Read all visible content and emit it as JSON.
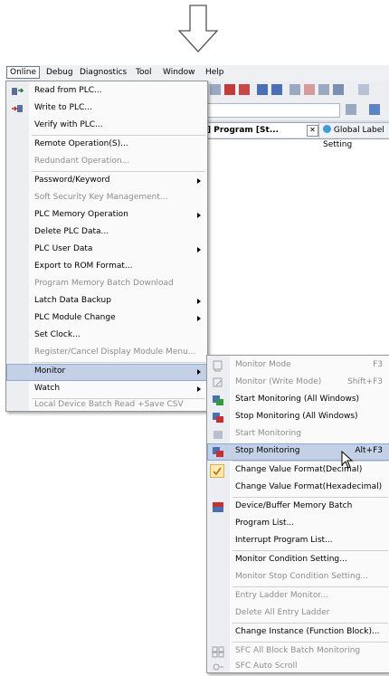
{
  "menubar": {
    "items": [
      "Online",
      "Debug",
      "Diagnostics",
      "Tool",
      "Window",
      "Help"
    ]
  },
  "tabs": {
    "program": "] Program [St...",
    "global": "Global Label Setting"
  },
  "online_menu": {
    "items": [
      {
        "label": "Read from PLC...",
        "enabled": true,
        "icon": "read-plc-icon"
      },
      {
        "label": "Write to PLC...",
        "enabled": true,
        "icon": "write-plc-icon"
      },
      {
        "label": "Verify with PLC...",
        "enabled": true
      },
      {
        "label": "Remote Operation(S)...",
        "enabled": true
      },
      {
        "label": "Redundant Operation...",
        "enabled": false
      },
      {
        "label": "Password/Keyword",
        "enabled": true,
        "submenu": true
      },
      {
        "label": "Soft Security Key Management...",
        "enabled": false
      },
      {
        "label": "PLC Memory Operation",
        "enabled": true,
        "submenu": true
      },
      {
        "label": "Delete PLC Data...",
        "enabled": true
      },
      {
        "label": "PLC User Data",
        "enabled": true,
        "submenu": true
      },
      {
        "label": "Export to ROM Format...",
        "enabled": true
      },
      {
        "label": "Program Memory Batch Download",
        "enabled": false
      },
      {
        "label": "Latch Data Backup",
        "enabled": true,
        "submenu": true
      },
      {
        "label": "PLC Module Change",
        "enabled": true,
        "submenu": true
      },
      {
        "label": "Set Clock...",
        "enabled": true
      },
      {
        "label": "Register/Cancel Display Module Menu...",
        "enabled": false
      },
      {
        "label": "Monitor",
        "enabled": true,
        "submenu": true,
        "highlighted": true
      },
      {
        "label": "Watch",
        "enabled": true,
        "submenu": true
      },
      {
        "label": "Local Device Batch Read +Save CSV",
        "enabled": false
      }
    ]
  },
  "monitor_menu": {
    "items": [
      {
        "label": "Monitor Mode",
        "shortcut": "F3",
        "enabled": false,
        "icon": "monitor-mode-icon"
      },
      {
        "label": "Monitor (Write Mode)",
        "shortcut": "Shift+F3",
        "enabled": false,
        "icon": "monitor-write-mode-icon"
      },
      {
        "label": "Start Monitoring (All Windows)",
        "enabled": true,
        "icon": "start-monitoring-all-icon"
      },
      {
        "label": "Stop Monitoring (All Windows)",
        "enabled": true,
        "icon": "stop-monitoring-all-icon"
      },
      {
        "label": "Start Monitoring",
        "enabled": false,
        "icon": "start-monitoring-icon"
      },
      {
        "label": "Stop Monitoring",
        "shortcut": "Alt+F3",
        "enabled": true,
        "highlighted": true,
        "icon": "stop-monitoring-icon"
      },
      {
        "label": "Change Value Format(Decimal)",
        "enabled": true,
        "checked": true
      },
      {
        "label": "Change Value Format(Hexadecimal)",
        "enabled": true
      },
      {
        "label": "Device/Buffer Memory Batch",
        "enabled": true,
        "icon": "device-batch-icon"
      },
      {
        "label": "Program List...",
        "enabled": true
      },
      {
        "label": "Interrupt Program List...",
        "enabled": true
      },
      {
        "label": "Monitor Condition Setting...",
        "enabled": true
      },
      {
        "label": "Monitor Stop Condition Setting...",
        "enabled": false
      },
      {
        "label": "Entry Ladder Monitor...",
        "enabled": false
      },
      {
        "label": "Delete All Entry Ladder",
        "enabled": false
      },
      {
        "label": "Change Instance (Function Block)...",
        "enabled": true
      },
      {
        "label": "SFC All Block Batch Monitoring",
        "enabled": false,
        "icon": "sfc-batch-icon"
      },
      {
        "label": "SFC Auto Scroll",
        "enabled": false,
        "icon": "sfc-scroll-icon"
      }
    ]
  },
  "colors": {
    "highlight": "#c3d0e6",
    "disabled_text": "#8d8d8d",
    "menu_bg": "#fafafa",
    "gutter_bg": "#eceef2"
  }
}
